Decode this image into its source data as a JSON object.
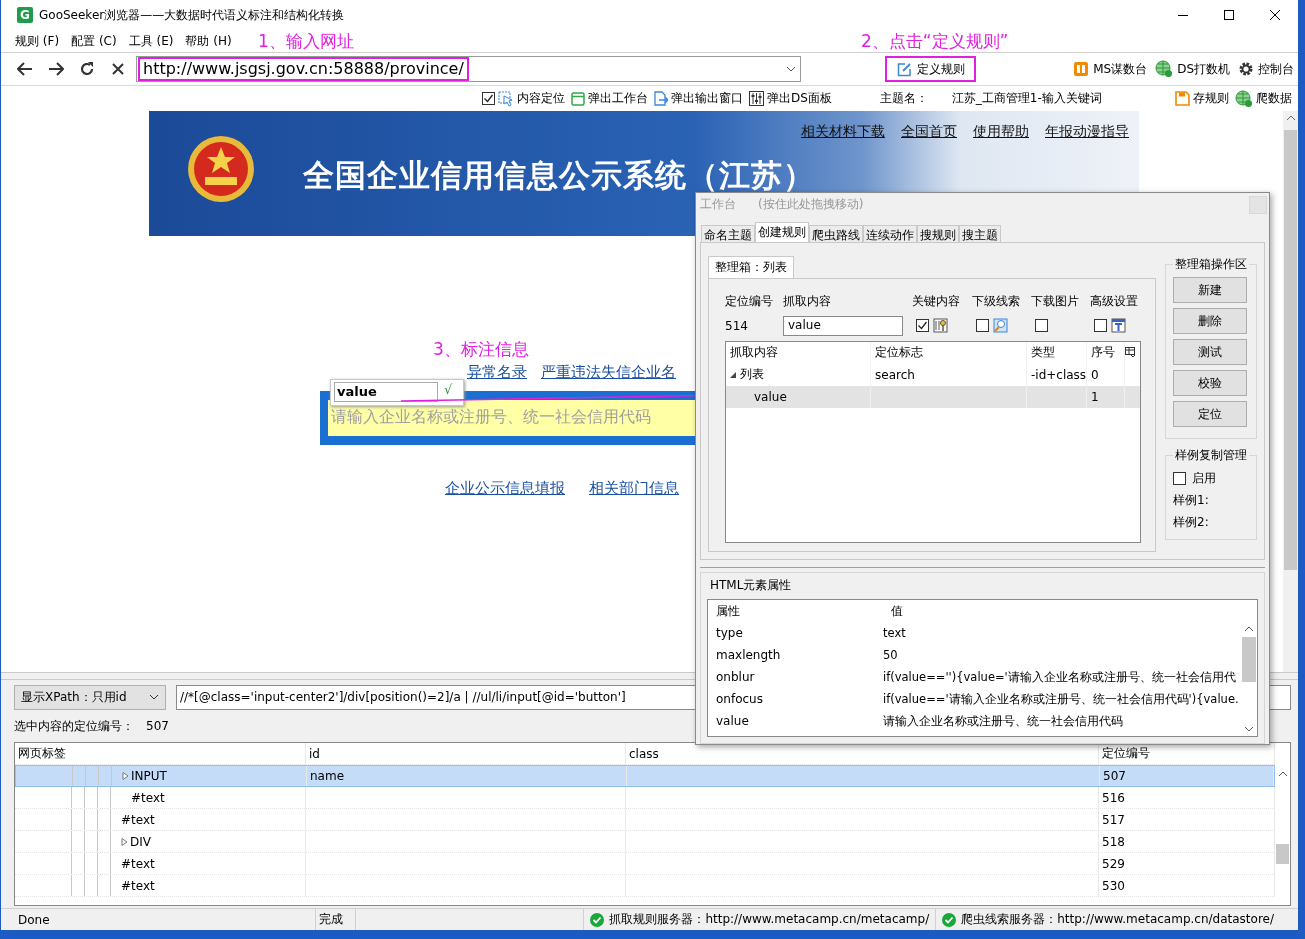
{
  "window": {
    "title": "GooSeeker浏览器——大数据时代语义标注和结构化转换",
    "app_icon": "G"
  },
  "menu": [
    "规则 (F)",
    "配置 (C)",
    "工具 (E)",
    "帮助 (H)"
  ],
  "annotations": [
    "1、输入网址",
    "2、点击“定义规则”",
    "3、标注信息"
  ],
  "address_bar": {
    "url": "http://www.jsgsj.gov.cn:58888/province/"
  },
  "define_rule_button": "定义规则",
  "tool_links": [
    "MS谋数台",
    "DS打数机",
    "控制台"
  ],
  "toolbar": [
    {
      "kind": "checkbox",
      "label": "内容定位",
      "checked": true
    },
    {
      "kind": "button",
      "label": "弹出工作台"
    },
    {
      "kind": "button",
      "label": "弹出输出窗口"
    },
    {
      "kind": "button",
      "label": "弹出DS面板"
    }
  ],
  "theme": {
    "label": "主题名：",
    "value": "江苏_工商管理1-输入关键词"
  },
  "theme_actions": [
    "存规则",
    "爬数据"
  ],
  "web_page": {
    "banner_title": "全国企业信用信息公示系统（江苏）",
    "banner_links": [
      "相关材料下载",
      "全国首页",
      "使用帮助",
      "年报动漫指导"
    ],
    "links": [
      "异常名录",
      "严重违法失信企业名"
    ],
    "search_placeholder": "请输入企业名称或注册号、统一社会信用代码",
    "tag_popup": {
      "value": "value",
      "confirm": "√"
    },
    "bottom_links": [
      "企业公示信息填报",
      "相关部门信息"
    ]
  },
  "workbench": {
    "title": "工作台",
    "hint": "(按住此处拖拽移动)",
    "tabs": [
      {
        "label": "命名主题",
        "selected": false
      },
      {
        "label": "创建规则",
        "selected": true
      },
      {
        "label": "爬虫路线",
        "selected": false
      },
      {
        "label": "连续动作",
        "selected": false
      },
      {
        "label": "搜规则",
        "selected": false
      },
      {
        "label": "搜主题",
        "selected": false
      }
    ],
    "box_tab": "整理箱：列表",
    "id_label": "定位编号",
    "id_value": "514",
    "content_label": "抓取内容",
    "content_value": "value",
    "options": [
      {
        "label": "关键内容",
        "checked": true
      },
      {
        "label": "下级线索",
        "checked": false
      },
      {
        "label": "下载图片",
        "checked": false
      },
      {
        "label": "高级设置",
        "checked": false
      }
    ],
    "rule_columns": [
      "抓取内容",
      "定位标志",
      "类型",
      "序号"
    ],
    "rules": [
      {
        "name": "列表",
        "flag": "search",
        "type": "-id+class",
        "index": "0",
        "expanded": true,
        "selected": false,
        "children": [
          {
            "name": "value",
            "index": "1",
            "selected": true
          }
        ]
      }
    ],
    "ops_title": "整理箱操作区",
    "ops_buttons": [
      "新建",
      "删除",
      "测试",
      "校验",
      "定位"
    ],
    "sample_title": "样例复制管理",
    "sample_enable": {
      "label": "启用",
      "checked": false
    },
    "samples": [
      "样例1:",
      "样例2:"
    ],
    "attr_title": "HTML元素属性",
    "attr_columns": [
      "属性",
      "值"
    ],
    "attributes": [
      {
        "name": "type",
        "value": "text"
      },
      {
        "name": "maxlength",
        "value": "50"
      },
      {
        "name": "onblur",
        "value": "if(value==''){value='请输入企业名称或注册号、统一社会信用代"
      },
      {
        "name": "onfocus",
        "value": "if(value=='请输入企业名称或注册号、统一社会信用代码'){value."
      },
      {
        "name": "value",
        "value": "请输入企业名称或注册号、统一社会信用代码"
      }
    ]
  },
  "inspector": {
    "xpath_mode": "显示XPath：只用id",
    "xpath": "//*[@class='input-center2']/div[position()=2]/a | //ul/li/input[@id='button']",
    "selected_label": "选中内容的定位编号：",
    "selected_number": "507",
    "columns": [
      "网页标签",
      "id",
      "class",
      "定位编号"
    ],
    "tree": [
      {
        "tag": "INPUT",
        "id": "name",
        "number": "507",
        "expanded": false,
        "selected": true,
        "children": [
          {
            "tag": "#text",
            "number": "516",
            "selected": false
          }
        ]
      },
      {
        "tag": "#text",
        "number": "517",
        "selected": false
      },
      {
        "tag": "DIV",
        "number": "518",
        "expanded": false,
        "selected": false
      },
      {
        "tag": "#text",
        "number": "529",
        "selected": false
      },
      {
        "tag": "#text",
        "number": "530",
        "selected": false
      }
    ]
  },
  "status_bar": {
    "items": [
      "Done",
      "完成"
    ],
    "servers": [
      {
        "label": "抓取规则服务器：http://www.metacamp.cn/metacamp/",
        "ok": true
      },
      {
        "label": "爬虫线索服务器：http://www.metacamp.cn/datastore/",
        "ok": true
      }
    ]
  }
}
